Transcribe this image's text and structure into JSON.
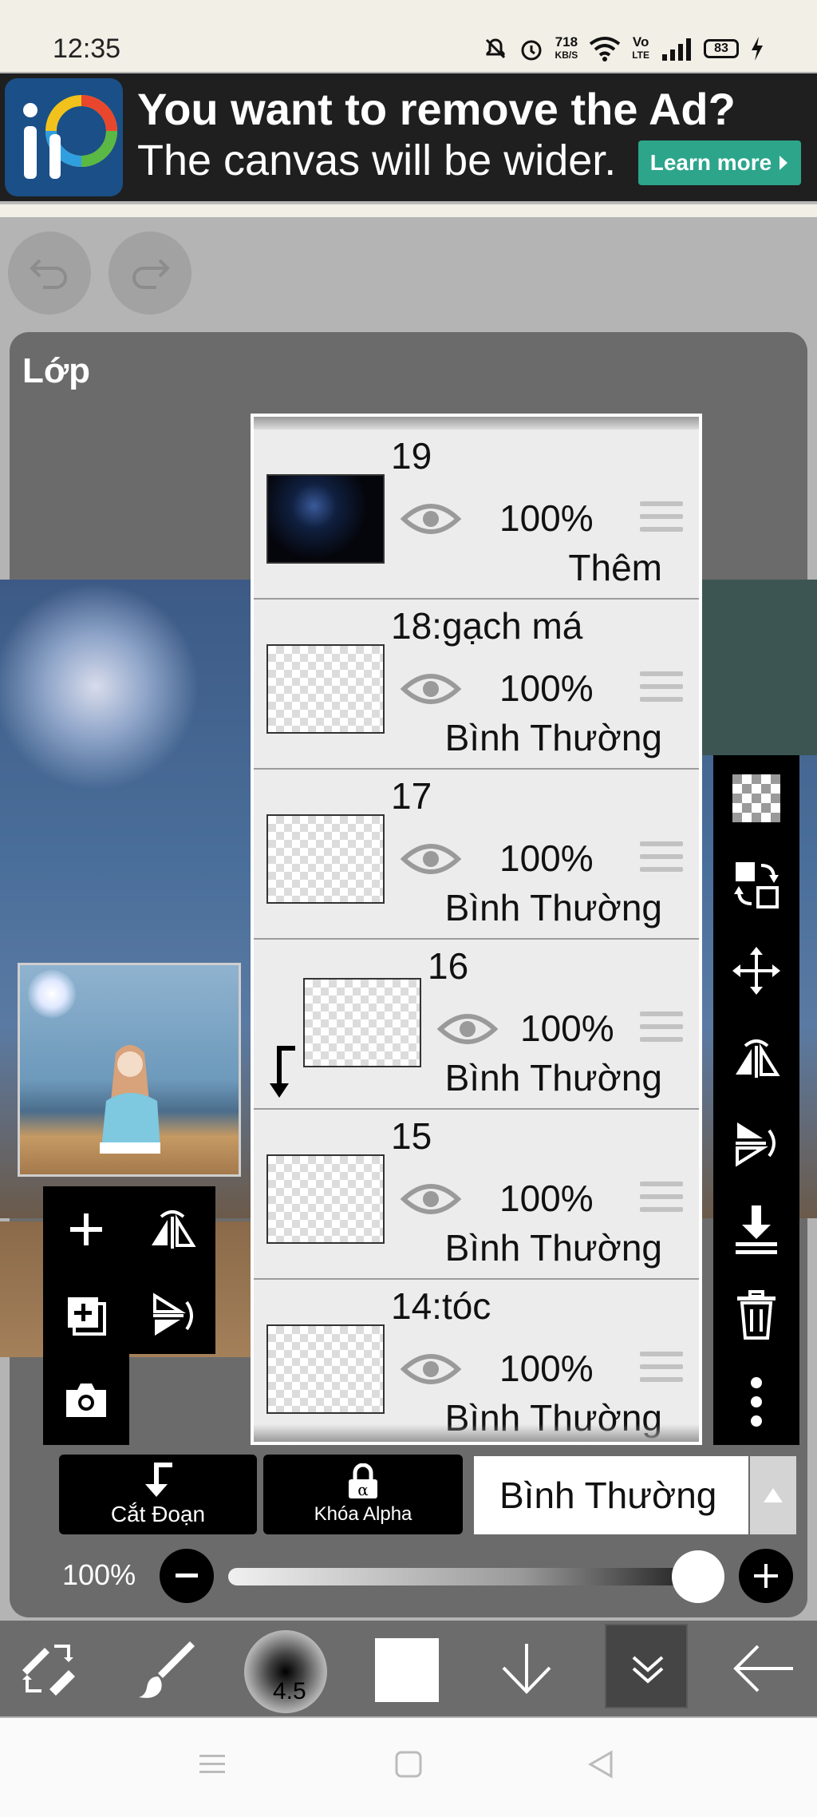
{
  "status_bar": {
    "time": "12:35",
    "network_speed_value": "718",
    "network_speed_unit": "KB/S",
    "volte_top": "Vo",
    "volte_bottom": "LTE",
    "battery": "83"
  },
  "ad": {
    "title": "You want to remove the Ad?",
    "subtitle": "The canvas will be wider.",
    "learn_more": "Learn more"
  },
  "panel": {
    "title": "Lớp"
  },
  "layers": [
    {
      "name": "19",
      "opacity": "100%",
      "blend": "Thêm",
      "clipped": false
    },
    {
      "name": "18:gạch má",
      "opacity": "100%",
      "blend": "Bình Thường",
      "clipped": false
    },
    {
      "name": "17",
      "opacity": "100%",
      "blend": "Bình Thường",
      "clipped": false
    },
    {
      "name": "16",
      "opacity": "100%",
      "blend": "Bình Thường",
      "clipped": true
    },
    {
      "name": "15",
      "opacity": "100%",
      "blend": "Bình Thường",
      "clipped": false
    },
    {
      "name": "14:tóc",
      "opacity": "100%",
      "blend": "Bình Thường",
      "clipped": false
    }
  ],
  "controls": {
    "clipping_label": "Cắt Đoạn",
    "alpha_lock_label": "Khóa Alpha",
    "blend_mode": "Bình Thường",
    "opacity_label": "100%",
    "opacity_value": 1.0
  },
  "toolbar": {
    "brush_size": "4.5"
  },
  "colors": {
    "panel": "#6b6b6b",
    "ad_button": "#2ca58b",
    "toolbar": "#6c6c6c"
  }
}
